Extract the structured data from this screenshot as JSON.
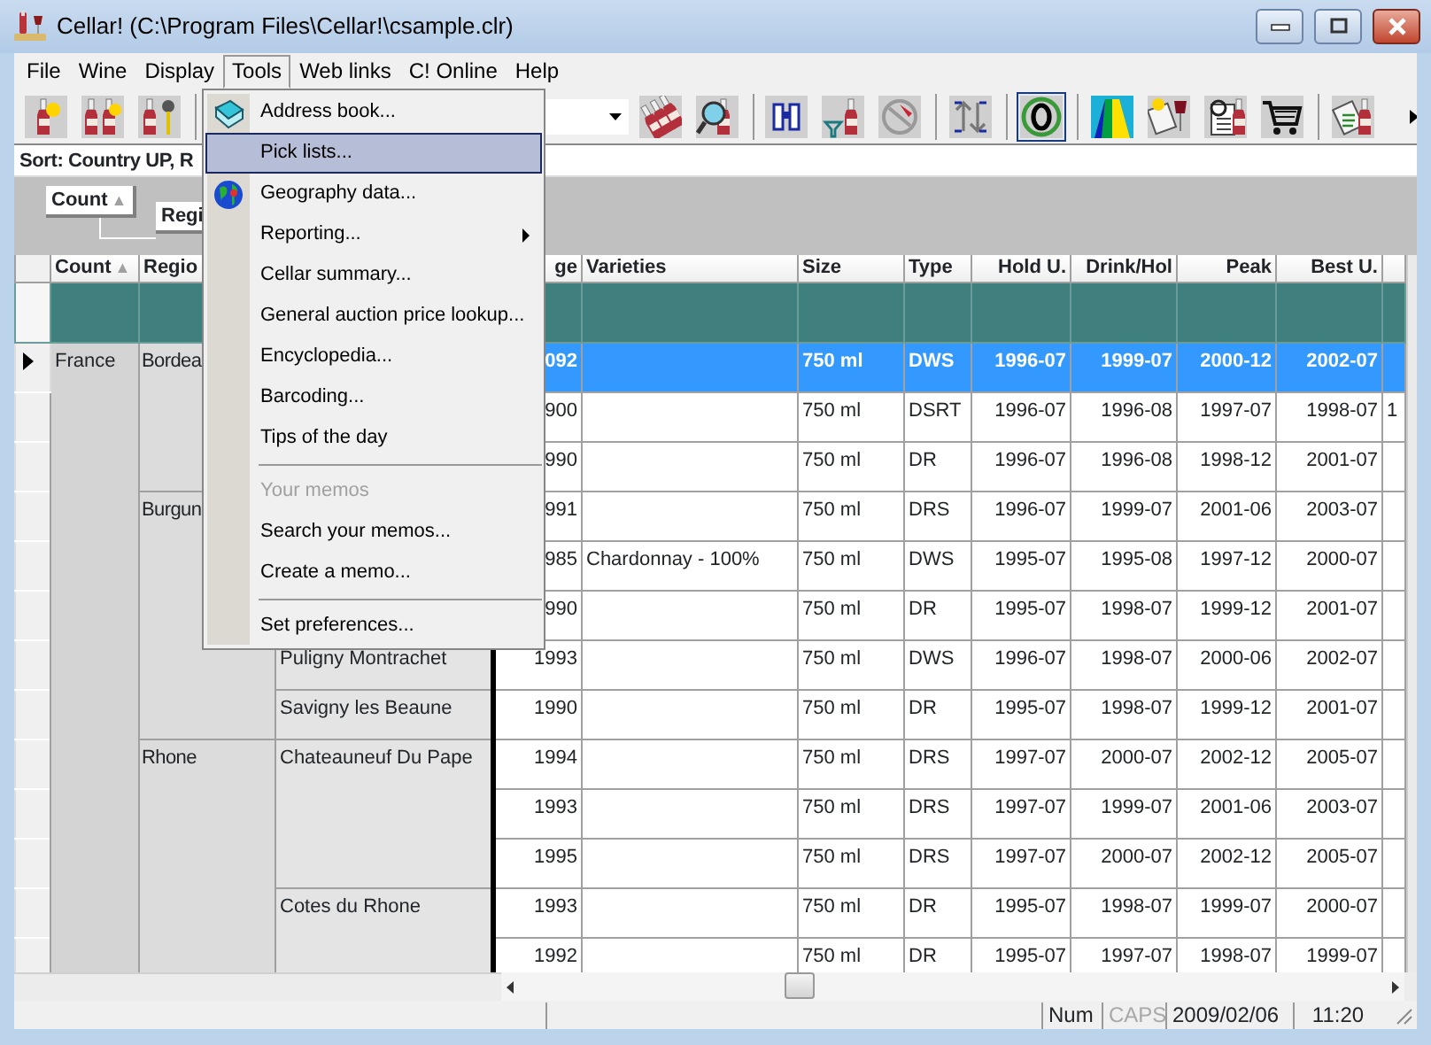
{
  "window": {
    "title": "Cellar! (C:\\Program Files\\Cellar!\\csample.clr)"
  },
  "menu_bar": [
    {
      "label": "File",
      "selected": false
    },
    {
      "label": "Wine",
      "selected": false
    },
    {
      "label": "Display",
      "selected": false
    },
    {
      "label": "Tools",
      "selected": true
    },
    {
      "label": "Web links",
      "selected": false
    },
    {
      "label": "C! Online",
      "selected": false
    },
    {
      "label": "Help",
      "selected": false
    }
  ],
  "toolbar": {
    "buttons": [
      {
        "pressed": false
      },
      {
        "pressed": false
      },
      {
        "pressed": false
      },
      {
        "pressed": false
      },
      {
        "pressed": false
      },
      {
        "pressed": false
      },
      {
        "pressed": false
      },
      {
        "pressed": false
      },
      {
        "pressed": false
      },
      {
        "pressed": true
      },
      {
        "pressed": false
      },
      {
        "pressed": false
      },
      {
        "pressed": false
      },
      {
        "pressed": false
      },
      {
        "pressed": false
      }
    ]
  },
  "sort_bar": {
    "text": "Sort: Country UP, R"
  },
  "group_panel": [
    {
      "label": "Count",
      "arrow": "▲"
    },
    {
      "label": "Regi"
    }
  ],
  "grid": {
    "columns": [
      {
        "label": "Count",
        "arrow": "▲"
      },
      {
        "label": "Regio"
      },
      {},
      {
        "label": "ge"
      },
      {
        "label": "Varieties"
      },
      {
        "label": "Size"
      },
      {
        "label": "Type"
      },
      {
        "label": "Hold U."
      },
      {
        "label": "Drink/Hol"
      },
      {
        "label": "Peak"
      },
      {
        "label": "Best U."
      },
      {}
    ],
    "tree": [
      {
        "country": "France",
        "regions": [
          {
            "name": "Bordea",
            "subregions": [
              {
                "wines": [
                  {
                    "selected": true,
                    "vintage": "092",
                    "size": "750 ml",
                    "type": "DWS",
                    "hold": "1996-07",
                    "drink": "1999-07",
                    "peak": "2000-12",
                    "best": "2002-07"
                  },
                  {
                    "selected": false,
                    "vintage": "900",
                    "size": "750 ml",
                    "type": "DSRT",
                    "hold": "1996-07",
                    "drink": "1996-08",
                    "peak": "1997-07",
                    "best": "1998-07",
                    "column_13": "1"
                  },
                  {
                    "selected": false,
                    "vintage": "990",
                    "size": "750 ml",
                    "type": "DR",
                    "hold": "1996-07",
                    "drink": "1996-08",
                    "peak": "1998-12",
                    "best": "2001-07"
                  }
                ]
              }
            ]
          },
          {
            "name": "Burgun",
            "subregions": [
              {
                "wines": [
                  {
                    "selected": false,
                    "vintage": "991",
                    "size": "750 ml",
                    "type": "DRS",
                    "hold": "1996-07",
                    "drink": "1999-07",
                    "peak": "2001-06",
                    "best": "2003-07"
                  },
                  {
                    "selected": false,
                    "vintage": "985",
                    "varieties": "Chardonnay - 100%",
                    "size": "750 ml",
                    "type": "DWS",
                    "hold": "1995-07",
                    "drink": "1995-08",
                    "peak": "1997-12",
                    "best": "2000-07"
                  },
                  {
                    "selected": false,
                    "vintage": "990",
                    "size": "750 ml",
                    "type": "DR",
                    "hold": "1995-07",
                    "drink": "1998-07",
                    "peak": "1999-12",
                    "best": "2001-07"
                  }
                ]
              },
              {
                "name": "Puligny Montrachet",
                "wines": [
                  {
                    "selected": false,
                    "vintage": "1993",
                    "size": "750 ml",
                    "type": "DWS",
                    "hold": "1996-07",
                    "drink": "1998-07",
                    "peak": "2000-06",
                    "best": "2002-07"
                  }
                ]
              },
              {
                "name": "Savigny les Beaune",
                "wines": [
                  {
                    "selected": false,
                    "vintage": "1990",
                    "size": "750 ml",
                    "type": "DR",
                    "hold": "1995-07",
                    "drink": "1998-07",
                    "peak": "1999-12",
                    "best": "2001-07"
                  }
                ]
              }
            ]
          },
          {
            "name": "Rhone",
            "subregions": [
              {
                "name": "Chateauneuf Du Pape",
                "wines": [
                  {
                    "selected": false,
                    "vintage": "1994",
                    "size": "750 ml",
                    "type": "DRS",
                    "hold": "1997-07",
                    "drink": "2000-07",
                    "peak": "2002-12",
                    "best": "2005-07"
                  },
                  {
                    "selected": false,
                    "vintage": "1993",
                    "size": "750 ml",
                    "type": "DRS",
                    "hold": "1997-07",
                    "drink": "1999-07",
                    "peak": "2001-06",
                    "best": "2003-07"
                  },
                  {
                    "selected": false,
                    "vintage": "1995",
                    "size": "750 ml",
                    "type": "DRS",
                    "hold": "1997-07",
                    "drink": "2000-07",
                    "peak": "2002-12",
                    "best": "2005-07"
                  }
                ]
              },
              {
                "name": "Cotes du Rhone",
                "wines": [
                  {
                    "selected": false,
                    "vintage": "1993",
                    "size": "750 ml",
                    "type": "DR",
                    "hold": "1995-07",
                    "drink": "1998-07",
                    "peak": "1999-07",
                    "best": "2000-07"
                  },
                  {
                    "selected": false,
                    "vintage": "1992",
                    "size": "750 ml",
                    "type": "DR",
                    "hold": "1995-07",
                    "drink": "1997-07",
                    "peak": "1998-07",
                    "best": "1999-07"
                  }
                ]
              }
            ]
          }
        ]
      }
    ]
  },
  "tools_menu": [
    {
      "kind": "icon_item",
      "label": "Address book...",
      "selected": false,
      "disabled": false
    },
    {
      "kind": "item",
      "label": "Pick lists...",
      "selected": true,
      "disabled": false
    },
    {
      "kind": "icon_item",
      "label": "Geography data...",
      "selected": false,
      "disabled": false
    },
    {
      "kind": "submenu",
      "label": "Reporting...",
      "selected": false,
      "disabled": false
    },
    {
      "kind": "item",
      "label": "Cellar summary...",
      "selected": false,
      "disabled": false
    },
    {
      "kind": "item",
      "label": "General auction price lookup...",
      "selected": false,
      "disabled": false
    },
    {
      "kind": "item",
      "label": "Encyclopedia...",
      "selected": false,
      "disabled": false
    },
    {
      "kind": "item",
      "label": "Barcoding...",
      "selected": false,
      "disabled": false
    },
    {
      "kind": "item",
      "label": "Tips of the day",
      "selected": false,
      "disabled": false
    },
    {
      "kind": "separator"
    },
    {
      "kind": "item",
      "label": "Your memos",
      "selected": false,
      "disabled": true
    },
    {
      "kind": "item",
      "label": "Search your memos...",
      "selected": false,
      "disabled": false
    },
    {
      "kind": "item",
      "label": "Create a memo...",
      "selected": false,
      "disabled": false
    },
    {
      "kind": "separator"
    },
    {
      "kind": "item",
      "label": "Set preferences...",
      "selected": false,
      "disabled": false
    }
  ],
  "status_bar": [
    {
      "text": "Num",
      "active": true
    },
    {
      "text": "CAPS",
      "active": false
    },
    {
      "text": "2009/02/06"
    },
    {
      "text": "11:20"
    }
  ]
}
